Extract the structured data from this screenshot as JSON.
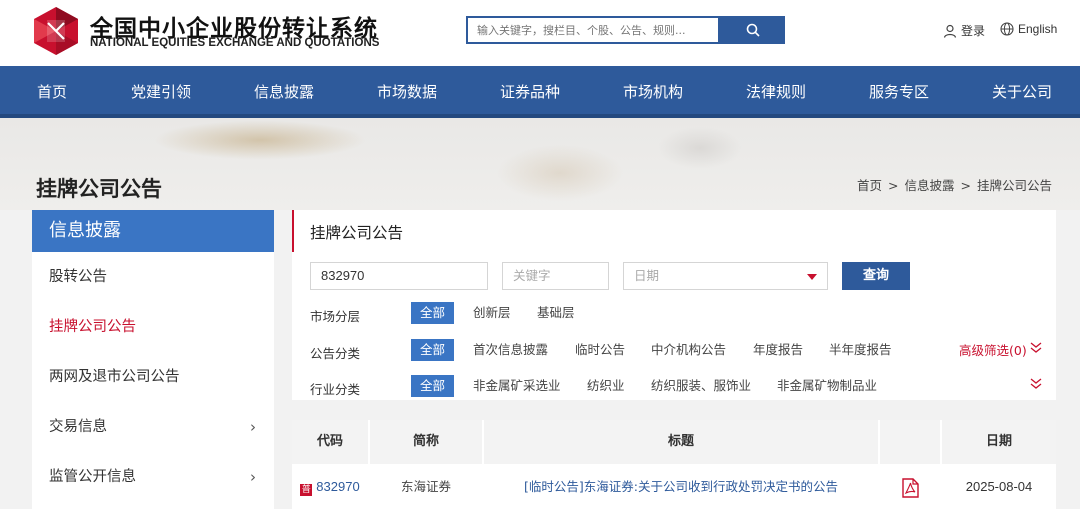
{
  "header": {
    "logo_cn": "全国中小企业股份转让系统",
    "logo_en": "NATIONAL EQUITIES EXCHANGE AND QUOTATIONS",
    "search_placeholder": "输入关键字，搜栏目、个股、公告、规则...",
    "login_label": "登录",
    "language_label": "English"
  },
  "nav": {
    "items": [
      "首页",
      "党建引领",
      "信息披露",
      "市场数据",
      "证券品种",
      "市场机构",
      "法律规则",
      "服务专区",
      "关于公司"
    ]
  },
  "page": {
    "title": "挂牌公司公告",
    "breadcrumb": [
      "首页",
      "信息披露",
      "挂牌公司公告"
    ],
    "breadcrumb_sep": ">"
  },
  "sidebar": {
    "heading": "信息披露",
    "items": [
      {
        "label": "股转公告",
        "active": false,
        "has_arrow": false
      },
      {
        "label": "挂牌公司公告",
        "active": true,
        "has_arrow": false
      },
      {
        "label": "两网及退市公司公告",
        "active": false,
        "has_arrow": false
      },
      {
        "label": "交易信息",
        "active": false,
        "has_arrow": true
      },
      {
        "label": "监管公开信息",
        "active": false,
        "has_arrow": true
      }
    ],
    "arrow_glyph": "›"
  },
  "main": {
    "heading": "挂牌公司公告",
    "filters": {
      "code_value": "832970",
      "keyword_placeholder": "关键字",
      "date_placeholder": "日期",
      "query_label": "查询"
    },
    "market_tier": {
      "label": "市场分层",
      "options": [
        "全部",
        "创新层",
        "基础层"
      ],
      "selected": "全部"
    },
    "announcement_type": {
      "label": "公告分类",
      "options": [
        "全部",
        "首次信息披露",
        "临时公告",
        "中介机构公告",
        "年度报告",
        "半年度报告"
      ],
      "selected": "全部"
    },
    "industry": {
      "label": "行业分类",
      "options": [
        "全部",
        "非金属矿采选业",
        "纺织业",
        "纺织服装、服饰业",
        "非金属矿物制品业"
      ],
      "selected": "全部"
    },
    "advanced_filter_label": "高级筛选(0)"
  },
  "table": {
    "headers": [
      "代码",
      "简称",
      "标题",
      "",
      "日期"
    ],
    "rows": [
      {
        "badge": "普",
        "code": "832970",
        "name": "东海证券",
        "title": "[临时公告]东海证券:关于公司收到行政处罚决定书的公告",
        "date": "2025-08-04"
      }
    ]
  },
  "colors": {
    "brand_blue": "#2e5a9b",
    "accent_blue": "#3a75c4",
    "accent_red": "#c8102e"
  }
}
